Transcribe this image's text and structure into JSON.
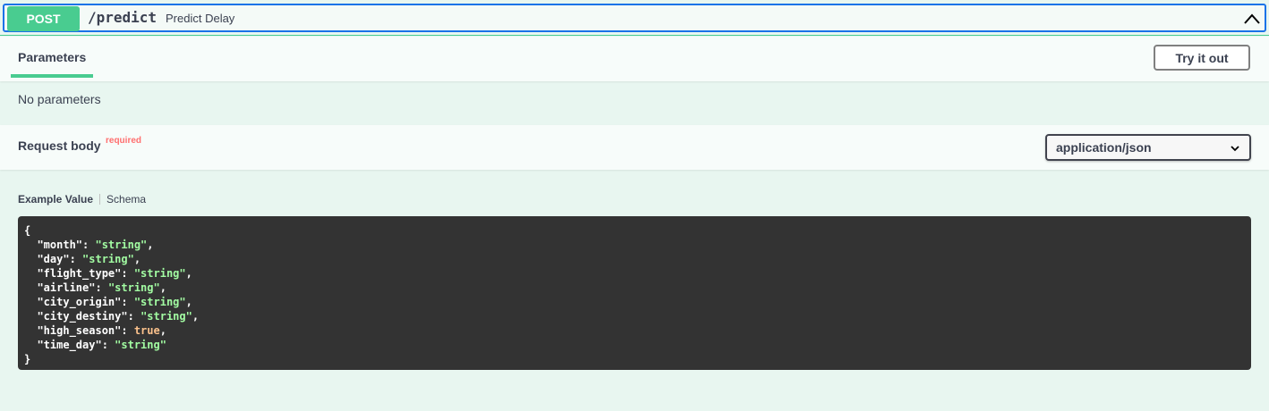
{
  "operation": {
    "method": "POST",
    "path": "/predict",
    "summary": "Predict Delay",
    "colors": {
      "method_bg": "#49cc90",
      "focus": "#1a73e8"
    }
  },
  "tabs": {
    "parameters": "Parameters",
    "try_it_out": "Try it out"
  },
  "parameters": {
    "empty_text": "No parameters"
  },
  "request_body": {
    "title": "Request body",
    "required_label": "required",
    "content_type": "application/json"
  },
  "model_tabs": {
    "example": "Example Value",
    "schema": "Schema"
  },
  "example": {
    "open_brace": "{",
    "close_brace": "}",
    "fields": [
      {
        "key": "\"month\"",
        "value": "\"string\"",
        "type": "string",
        "comma": ","
      },
      {
        "key": "\"day\"",
        "value": "\"string\"",
        "type": "string",
        "comma": ","
      },
      {
        "key": "\"flight_type\"",
        "value": "\"string\"",
        "type": "string",
        "comma": ","
      },
      {
        "key": "\"airline\"",
        "value": "\"string\"",
        "type": "string",
        "comma": ","
      },
      {
        "key": "\"city_origin\"",
        "value": "\"string\"",
        "type": "string",
        "comma": ","
      },
      {
        "key": "\"city_destiny\"",
        "value": "\"string\"",
        "type": "string",
        "comma": ","
      },
      {
        "key": "\"high_season\"",
        "value": "true",
        "type": "boolean",
        "comma": ","
      },
      {
        "key": "\"time_day\"",
        "value": "\"string\"",
        "type": "string",
        "comma": ""
      }
    ]
  }
}
